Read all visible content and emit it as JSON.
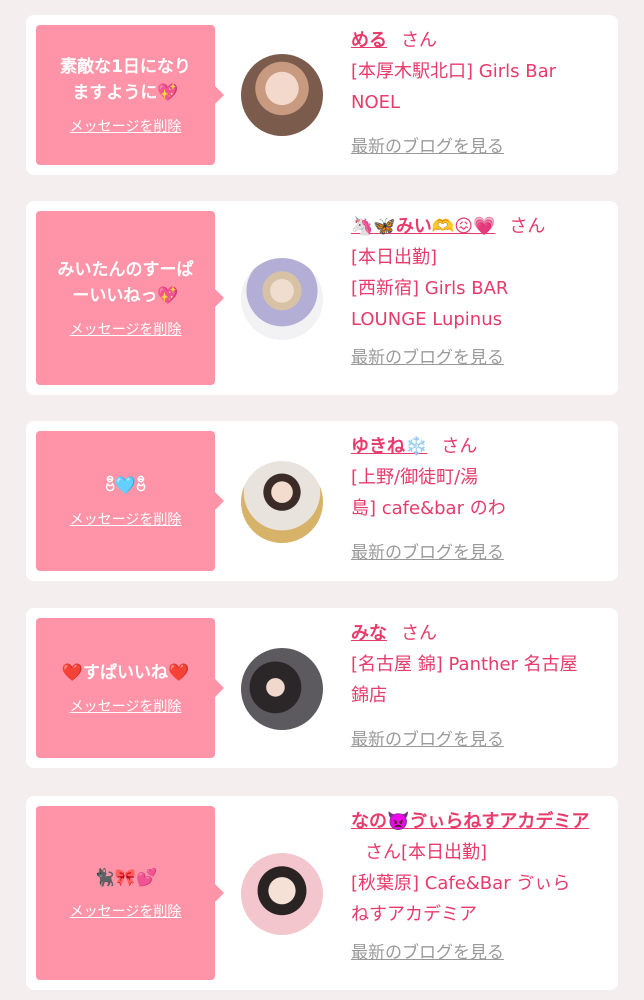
{
  "cards": [
    {
      "message": "素敵な1日になり\nますように💖",
      "delete_label": "メッセージを削除",
      "name": "める",
      "honorific": "さん",
      "info_lines": [
        "[本厚木駅北口] Girls Bar",
        "NOEL"
      ],
      "blog_label": "最新のブログを見る"
    },
    {
      "message": "みいたんのすーぱ\nーいいねっ💖",
      "delete_label": "メッセージを削除",
      "name": "🦄🦋みい🫶😖💗",
      "honorific": "さん",
      "info_lines": [
        "[本日出勤]",
        "[西新宿] Girls BAR",
        "LOUNGE Lupinus"
      ],
      "blog_label": "最新のブログを見る"
    },
    {
      "message": "ဗီ🩵ဗီ",
      "delete_label": "メッセージを削除",
      "name": "ゆきね❄️",
      "honorific": "さん",
      "info_lines": [
        "[上野/御徒町/湯",
        "島] cafe&bar のわ"
      ],
      "blog_label": "最新のブログを見る"
    },
    {
      "message": "❤️すぱいいね❤️",
      "delete_label": "メッセージを削除",
      "name": "みな",
      "honorific": "さん",
      "info_lines": [
        "[名古屋 錦] Panther 名古屋",
        "錦店"
      ],
      "blog_label": "最新のブログを見る"
    },
    {
      "message": "🐈‍⬛🎀💕",
      "delete_label": "メッセージを削除",
      "name": "なの👿ゔぃらねすアカデミア",
      "honorific": "さん",
      "name_suffix": "[本日出勤]",
      "info_lines": [
        "[秋葉原] Cafe&Bar ゔぃら",
        "ねすアカデミア"
      ],
      "blog_label": "最新のブログを見る"
    }
  ]
}
